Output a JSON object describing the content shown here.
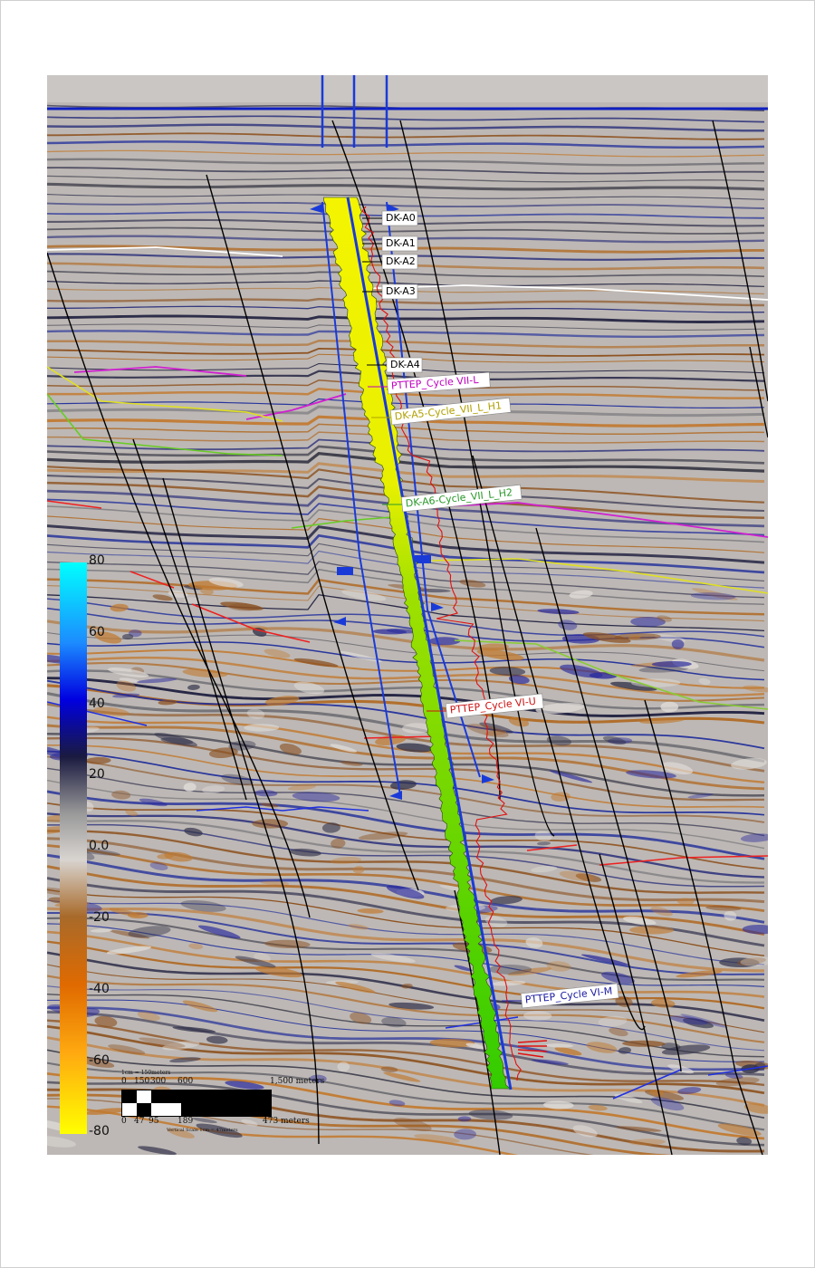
{
  "horizons": [
    {
      "name": "DK-A0",
      "color": "#000000"
    },
    {
      "name": "DK-A1",
      "color": "#000000"
    },
    {
      "name": "DK-A2",
      "color": "#000000"
    },
    {
      "name": "DK-A3",
      "color": "#000000"
    },
    {
      "name": "DK-A4",
      "color": "#000000"
    },
    {
      "name": "PTTEP_Cycle VII-L",
      "color": "#c000c0"
    },
    {
      "name": "DK-A5-Cycle_VII_L_H1",
      "color": "#b0a000"
    },
    {
      "name": "DK-A6-Cycle_VII_L_H2",
      "color": "#2a9a2a"
    },
    {
      "name": "PTTEP_Cycle VI-U",
      "color": "#cc1111"
    },
    {
      "name": "PTTEP_Cycle VI-M",
      "color": "#1a1aa0"
    }
  ],
  "colorbar": {
    "ticks": [
      "80",
      "60",
      "40",
      "20",
      "0.0",
      "-20",
      "-40",
      "-60",
      "-80"
    ]
  },
  "scalebar": {
    "header": "1cm = 150meters",
    "top_ticks": [
      "0",
      "150",
      "300",
      "600",
      "1,500 meters"
    ],
    "bottom_ticks": [
      "0",
      "47",
      "95",
      "189",
      "473 meters"
    ],
    "footer": "Vertical Scale 1cm = 47meters"
  },
  "colors": {
    "well_log_fill": "#f2f200",
    "well_log_fill_deep": "#4cd400",
    "well_track": "#1a3ad8",
    "velocity_log": "#e01010",
    "fault": "#000000"
  }
}
